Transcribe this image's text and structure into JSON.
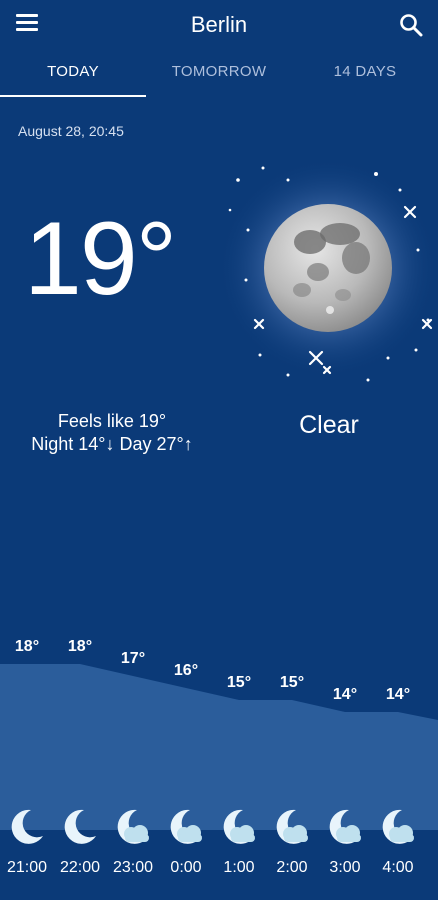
{
  "header": {
    "city": "Berlin"
  },
  "tabs": [
    {
      "label": "TODAY",
      "active": true
    },
    {
      "label": "TOMORROW",
      "active": false
    },
    {
      "label": "14 DAYS",
      "active": false
    }
  ],
  "current": {
    "timestamp": "August 28, 20:45",
    "temperature": "19°",
    "feels_like": "Feels like 19°",
    "night_day": "Night 14°↓ Day 27°↑",
    "condition": "Clear",
    "icon": "full-moon-icon"
  },
  "hourly": [
    {
      "time": "21:00",
      "temp": "18°",
      "icon": "crescent-moon-icon"
    },
    {
      "time": "22:00",
      "temp": "18°",
      "icon": "crescent-moon-icon"
    },
    {
      "time": "23:00",
      "temp": "17°",
      "icon": "moon-cloud-icon"
    },
    {
      "time": "0:00",
      "temp": "16°",
      "icon": "moon-cloud-icon"
    },
    {
      "time": "1:00",
      "temp": "15°",
      "icon": "moon-cloud-icon"
    },
    {
      "time": "2:00",
      "temp": "15°",
      "icon": "moon-cloud-icon"
    },
    {
      "time": "3:00",
      "temp": "14°",
      "icon": "moon-cloud-icon"
    },
    {
      "time": "4:00",
      "temp": "14°",
      "icon": "moon-cloud-icon"
    }
  ],
  "colors": {
    "background": "#0b3a78",
    "graph_fill": "#2b5d9b",
    "tab_inactive": "#aebfdc",
    "text": "#ffffff"
  }
}
